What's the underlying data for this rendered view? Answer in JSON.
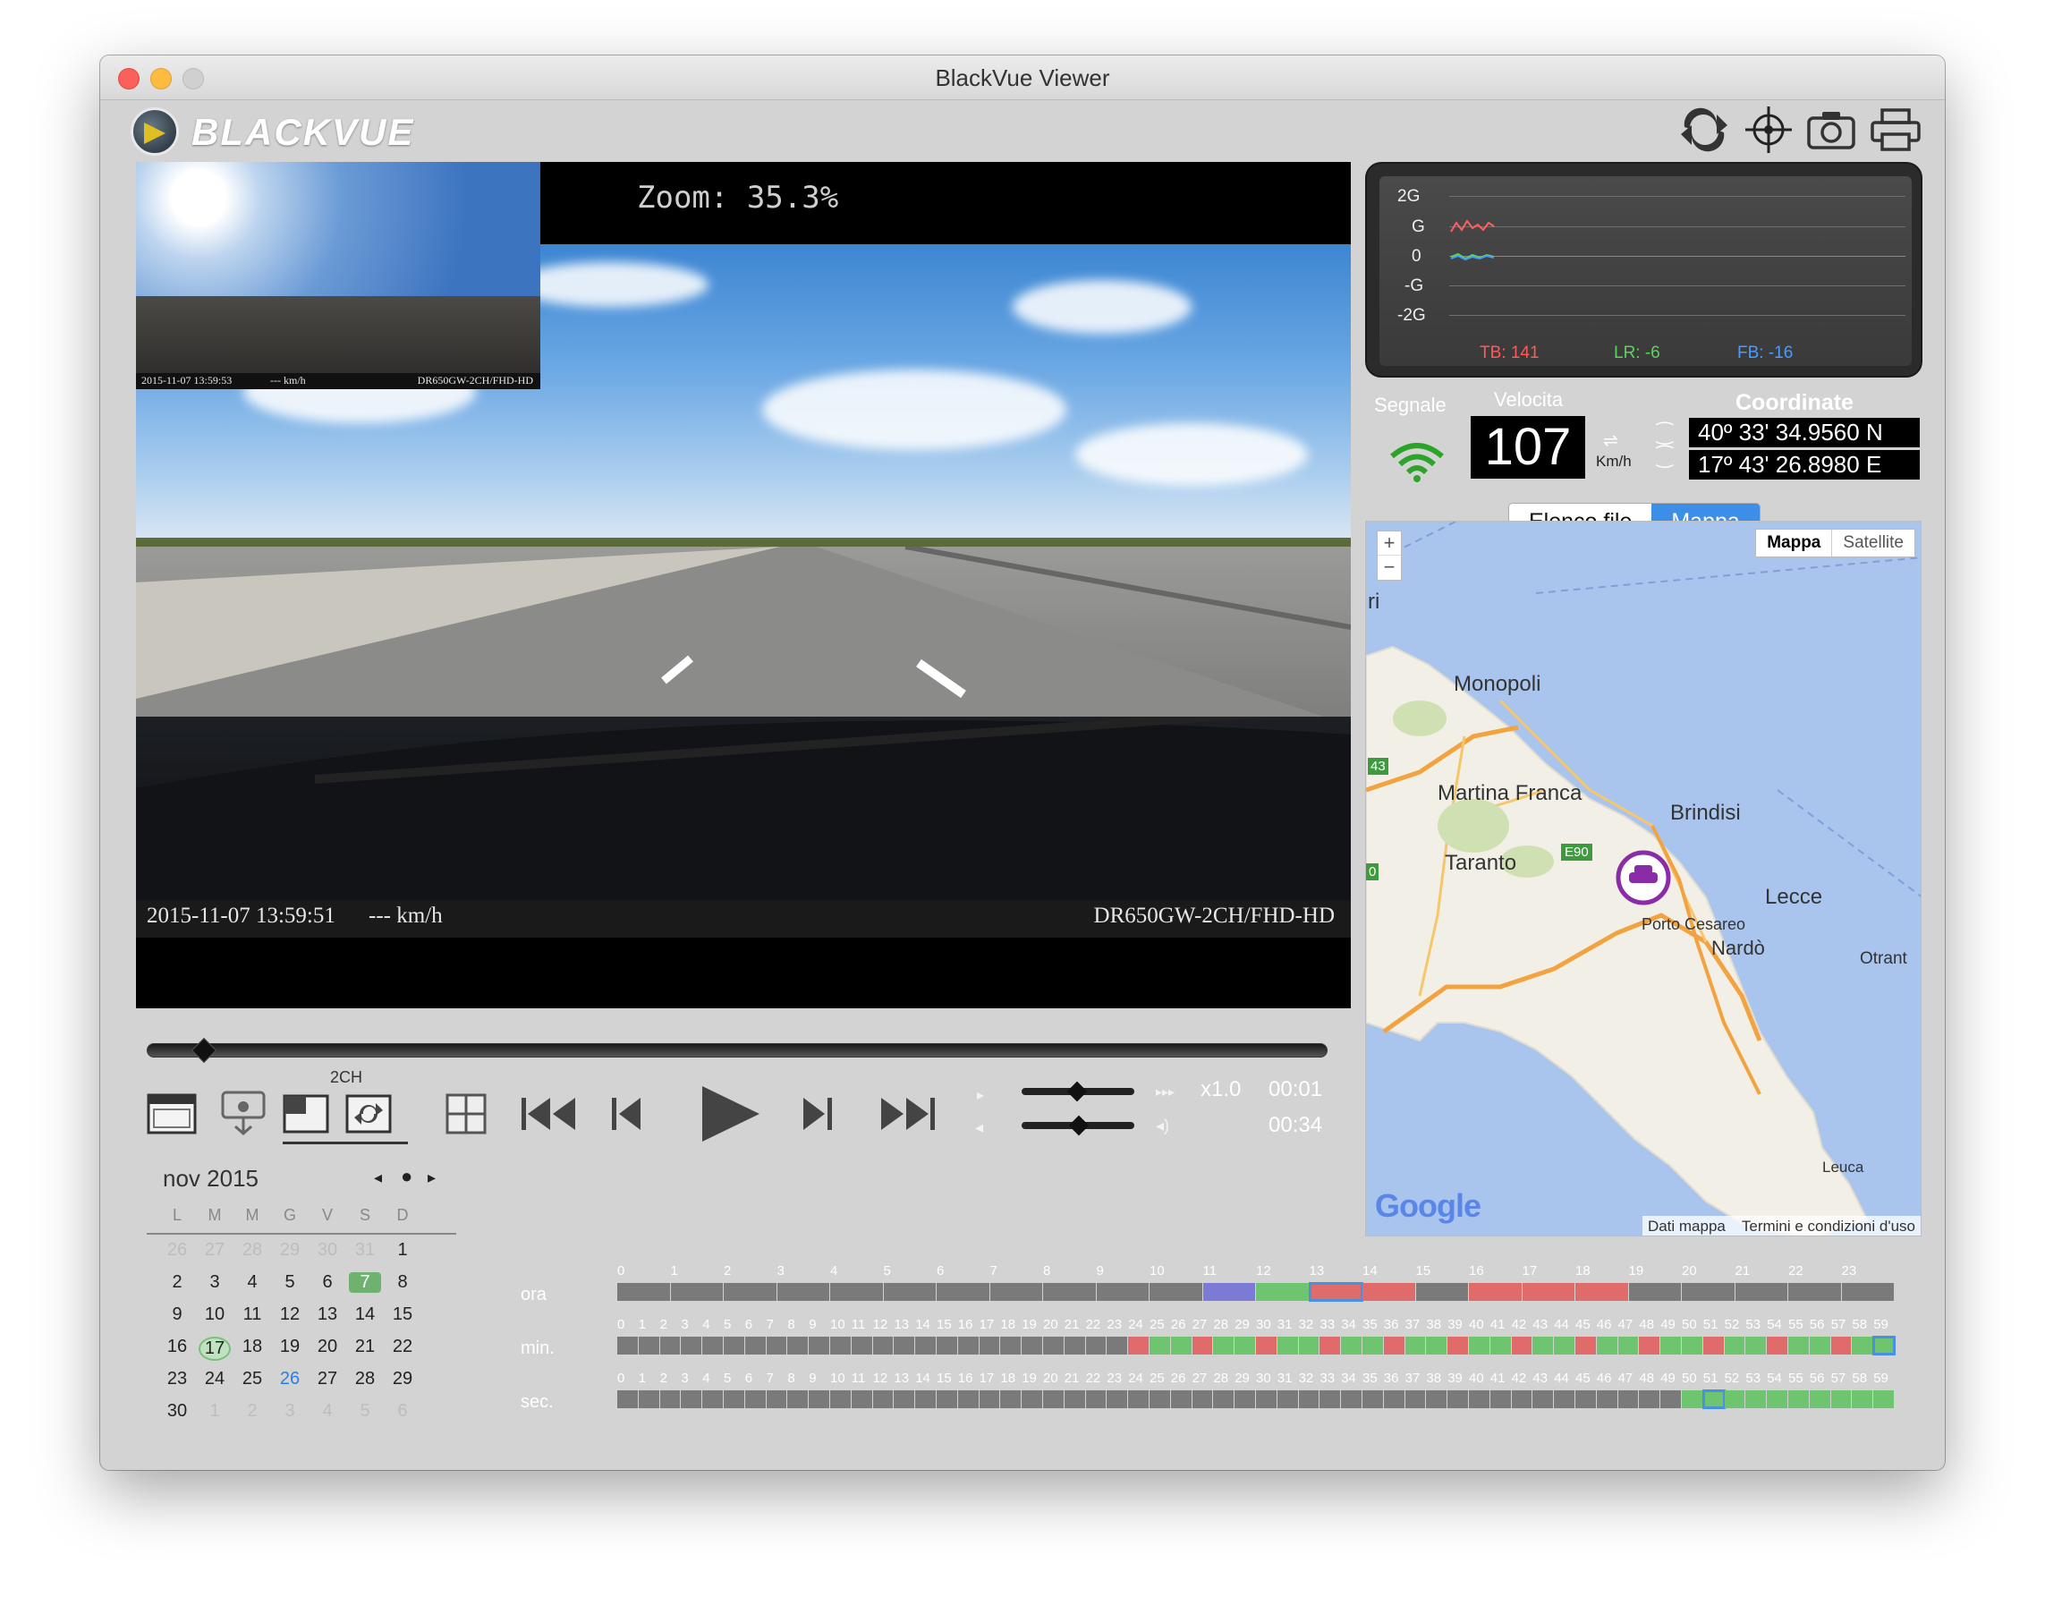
{
  "window": {
    "title": "BlackVue Viewer"
  },
  "brand": {
    "logo_text": "BLACKVUE"
  },
  "toolbar": {
    "icons": [
      "switch-camera-icon",
      "gps-crosshair-icon",
      "camera-snapshot-icon",
      "printer-icon"
    ]
  },
  "video": {
    "zoom": "Zoom: 35.3%",
    "osd_datetime": "2015-11-07  13:59:51",
    "osd_speed": "--- km/h",
    "osd_model": "DR650GW-2CH/FHD-HD",
    "pip_datetime": "2015-11-07  13:59:53",
    "pip_speed": "--- km/h",
    "pip_model": "DR650GW-2CH/FHD-HD"
  },
  "gsensor": {
    "y_labels": [
      "2G",
      "G",
      "0",
      "-G",
      "-2G"
    ],
    "tb": "TB: 141",
    "lr": "LR: -6",
    "fb": "FB: -16",
    "colors": {
      "tb": "#ff5a5a",
      "lr": "#5ad65a",
      "fb": "#4a9cff"
    }
  },
  "status": {
    "signal_label": "Segnale",
    "speed_label": "Velocita",
    "speed_value": "107",
    "speed_unit": "Km/h",
    "coord_label": "Coordinate",
    "lat": "40º 33' 34.9560 N",
    "lon": "17º 43' 26.8980 E"
  },
  "tabs": {
    "file_list": "Elenco file",
    "map": "Mappa",
    "active": "Mappa"
  },
  "map": {
    "type_map": "Mappa",
    "type_satellite": "Satellite",
    "zoom_in": "+",
    "zoom_out": "−",
    "labels": [
      "Monopoli",
      "Martina Franca",
      "Brindisi",
      "Taranto",
      "Lecce",
      "Porto Cesareo",
      "Nardò",
      "Otrant",
      "Leuca",
      "E90",
      "43",
      "ri",
      "0"
    ],
    "provider": "Google",
    "footer_data": "Dati mappa",
    "footer_terms": "Termini e condizioni d'uso"
  },
  "playback": {
    "channel_label": "2CH",
    "speed": "x1.0",
    "time_current": "00:01",
    "time_total": "00:34"
  },
  "calendar": {
    "month": "nov 2015",
    "weekdays": [
      "L",
      "M",
      "M",
      "G",
      "V",
      "S",
      "D"
    ],
    "weeks": [
      [
        "26",
        "27",
        "28",
        "29",
        "30",
        "31",
        "1"
      ],
      [
        "2",
        "3",
        "4",
        "5",
        "6",
        "7",
        "8"
      ],
      [
        "9",
        "10",
        "11",
        "12",
        "13",
        "14",
        "15"
      ],
      [
        "16",
        "17",
        "18",
        "19",
        "20",
        "21",
        "22"
      ],
      [
        "23",
        "24",
        "25",
        "26",
        "27",
        "28",
        "29"
      ],
      [
        "30",
        "1",
        "2",
        "3",
        "4",
        "5",
        "6"
      ]
    ],
    "selected": "7",
    "today": "17",
    "highlight_blue": "26"
  },
  "timeline": {
    "hour_label": "ora",
    "min_label": "min.",
    "sec_label": "sec.",
    "colors": {
      "empty": "#7a7a7a",
      "normal": "#6fc46f",
      "event": "#e06b6b",
      "manual": "#7b7bd6",
      "select": "#4a90e2"
    }
  }
}
